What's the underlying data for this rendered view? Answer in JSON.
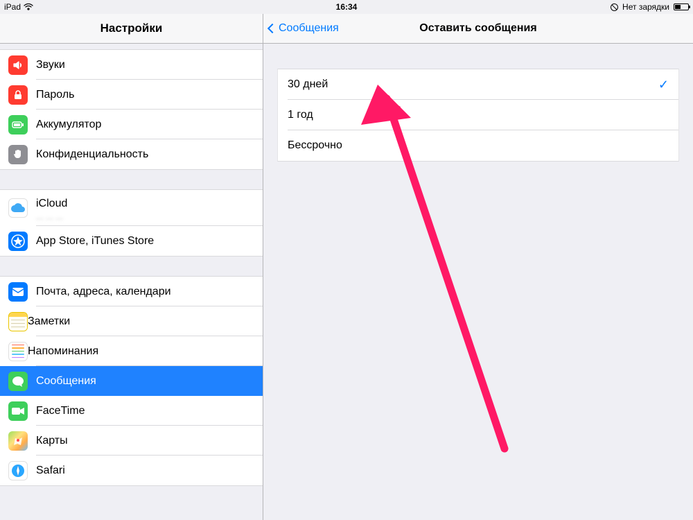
{
  "statusbar": {
    "device": "iPad",
    "time": "16:34",
    "charging_text": "Нет зарядки"
  },
  "sidebar": {
    "title": "Настройки",
    "groups": [
      [
        {
          "id": "sounds",
          "icon": "speaker",
          "color": "ic-red",
          "label": "Звуки"
        },
        {
          "id": "passcode",
          "icon": "lock",
          "color": "ic-red",
          "label": "Пароль"
        },
        {
          "id": "battery",
          "icon": "battery",
          "color": "ic-green",
          "label": "Аккумулятор"
        },
        {
          "id": "privacy",
          "icon": "hand",
          "color": "ic-gray",
          "label": "Конфиденциальность"
        }
      ],
      [
        {
          "id": "icloud",
          "icon": "cloud",
          "color": "ic-white",
          "label": "iCloud",
          "subtitle": "··· ··· ···"
        },
        {
          "id": "appstore",
          "icon": "appstore",
          "color": "ic-blue",
          "label": "App Store, iTunes Store"
        }
      ],
      [
        {
          "id": "mail",
          "icon": "mail",
          "color": "ic-blue",
          "label": "Почта, адреса, календари"
        },
        {
          "id": "notes",
          "icon": "notes",
          "color": "ic-yellow",
          "label": "Заметки"
        },
        {
          "id": "reminders",
          "icon": "reminders",
          "color": "ic-white",
          "label": "Напоминания"
        },
        {
          "id": "messages",
          "icon": "bubble",
          "color": "ic-green",
          "label": "Сообщения",
          "selected": true
        },
        {
          "id": "facetime",
          "icon": "camcorder",
          "color": "ic-cam",
          "label": "FaceTime"
        },
        {
          "id": "maps",
          "icon": "maps",
          "color": "ic-maps",
          "label": "Карты"
        },
        {
          "id": "safari",
          "icon": "compass",
          "color": "ic-safari",
          "label": "Safari"
        }
      ]
    ]
  },
  "detail": {
    "back_label": "Сообщения",
    "title": "Оставить сообщения",
    "options": [
      {
        "id": "30d",
        "label": "30 дней",
        "selected": true
      },
      {
        "id": "1y",
        "label": "1 год",
        "selected": false
      },
      {
        "id": "forever",
        "label": "Бессрочно",
        "selected": false
      }
    ]
  },
  "annotation": {
    "arrow_color": "#ff1965"
  }
}
